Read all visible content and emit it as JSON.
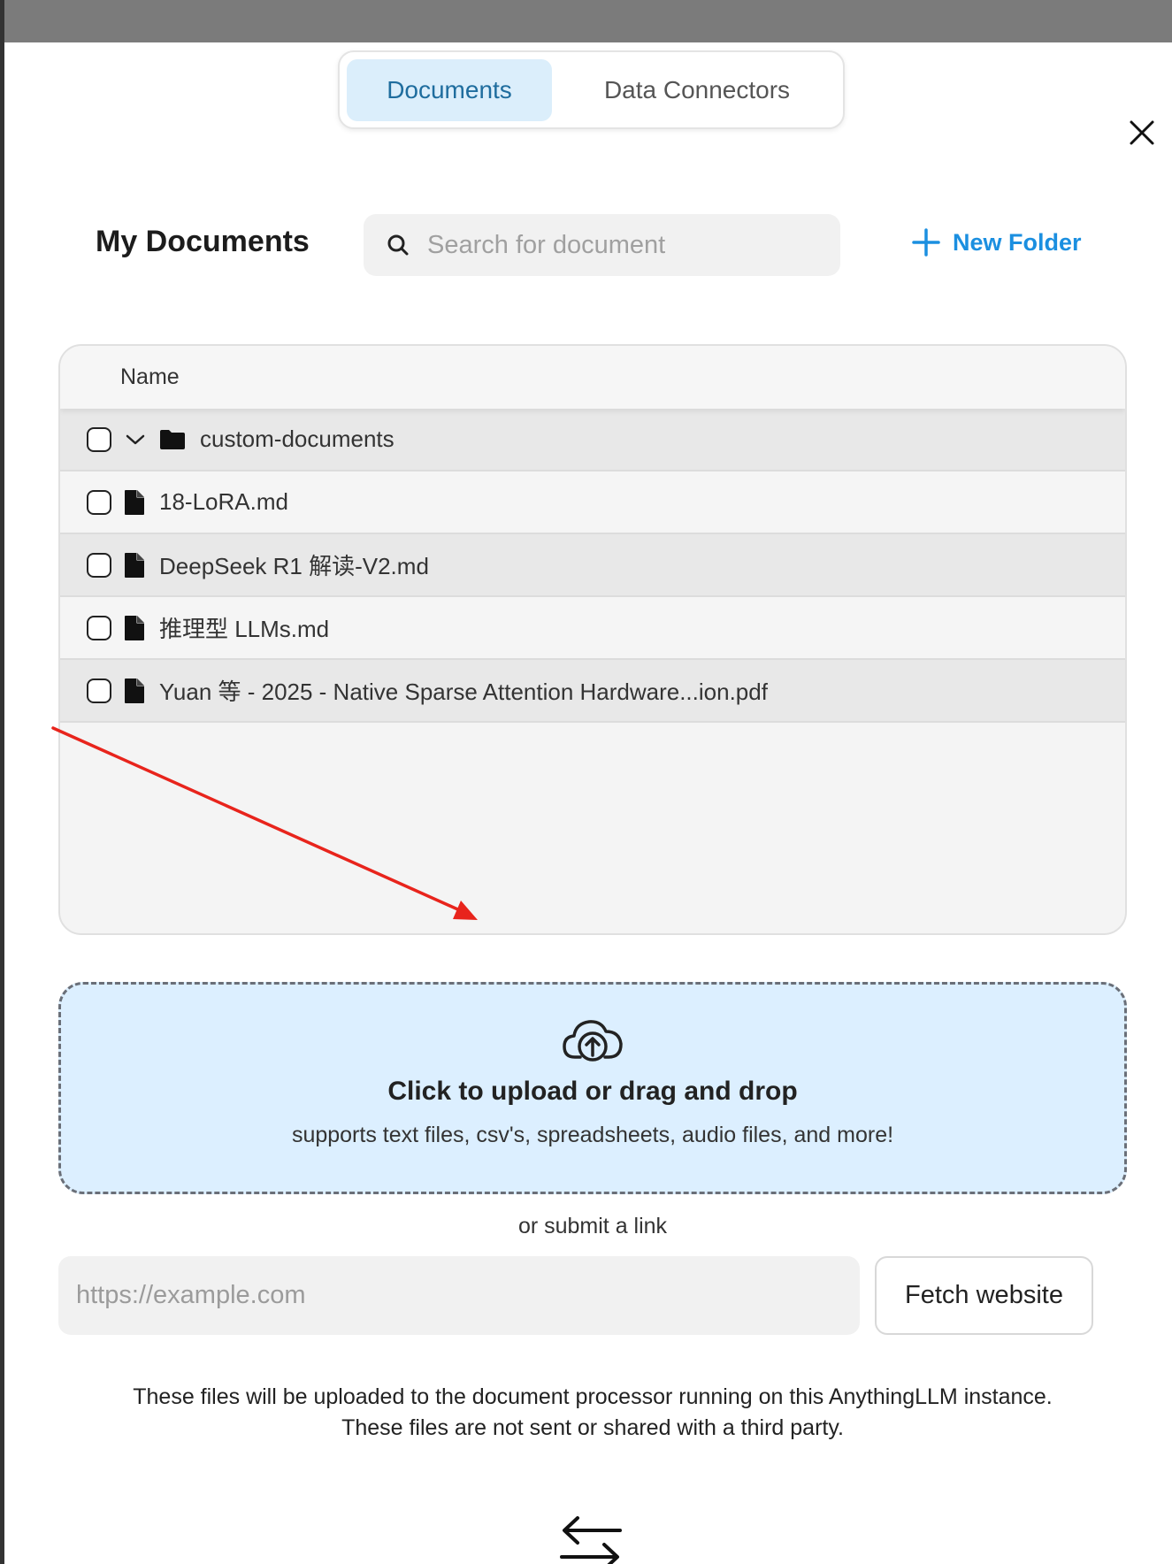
{
  "tabs": [
    {
      "label": "Documents",
      "active": true
    },
    {
      "label": "Data Connectors",
      "active": false
    }
  ],
  "header": {
    "title": "My Documents",
    "search_placeholder": "Search for document",
    "new_folder_label": "New Folder"
  },
  "table": {
    "column_name": "Name",
    "folder": {
      "name": "custom-documents",
      "expanded": true
    },
    "files": [
      {
        "name": "18-LoRA.md"
      },
      {
        "name": "DeepSeek R1 解读-V2.md"
      },
      {
        "name": "推理型 LLMs.md"
      },
      {
        "name": "Yuan 等 - 2025 - Native Sparse Attention Hardware...ion.pdf"
      }
    ]
  },
  "upload": {
    "title": "Click to upload or drag and drop",
    "subtitle": "supports text files, csv's, spreadsheets, audio files, and more!"
  },
  "link": {
    "or_text": "or submit a link",
    "placeholder": "https://example.com",
    "fetch_label": "Fetch website"
  },
  "notice": {
    "line1": "These files will be uploaded to the document processor running on this AnythingLLM instance.",
    "line2": "These files are not sent or shared with a third party."
  },
  "colors": {
    "accent": "#1b8fe0",
    "tab_active_bg": "#dbeefb",
    "upload_bg": "#dcefff",
    "annotation_arrow": "#e8241c"
  },
  "icons": [
    "close-icon",
    "search-icon",
    "plus-icon",
    "chevron-down-icon",
    "folder-icon",
    "file-icon",
    "cloud-upload-icon",
    "swap-arrows-icon"
  ]
}
